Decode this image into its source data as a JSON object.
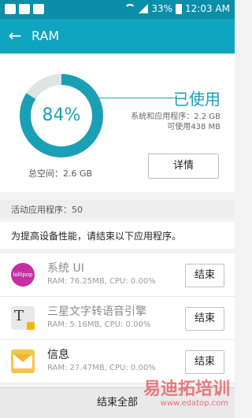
{
  "status_bar": {
    "battery": "33%",
    "time": "12:03 AM",
    "icons": [
      "warning-icon",
      "image-icon",
      "mail-icon",
      "wifi-icon",
      "signal-icon",
      "battery-icon"
    ]
  },
  "app_bar": {
    "title": "RAM",
    "back_icon": "back-arrow-icon"
  },
  "memory": {
    "percent_label": "84%",
    "used_fraction": 0.84,
    "used_label": "已使用",
    "system_apps": "系统和应用程序：2.2 GB",
    "available": "可使用438 MB",
    "total": "总空间：2.6 GB",
    "details_button": "详情"
  },
  "section": {
    "active_apps": "活动应用程序：50"
  },
  "tip": "为提高设备性能，请结束以下应用程序。",
  "apps": [
    {
      "name": "系统 UI",
      "meta": "RAM: 76.25MB, CPU: 0.00%",
      "icon": "lollipop-icon",
      "icon_text": "lollipop",
      "end_label": "结束"
    },
    {
      "name": "三星文字转语音引擎",
      "meta": "RAM: 5.16MB, CPU: 0.00%",
      "icon": "tts-icon",
      "end_label": "结束"
    },
    {
      "name": "信息",
      "meta": "RAM: 27.47MB, CPU: 0.00%",
      "icon": "message-icon",
      "end_label": "结束"
    }
  ],
  "end_all": "结束全部",
  "watermark": {
    "brand": "易迪拓培训",
    "url": "www.edatop.com"
  },
  "colors": {
    "accent": "#1b9fb6",
    "appbar": "#0fa4c0",
    "statusbar": "#0b8ea8"
  }
}
